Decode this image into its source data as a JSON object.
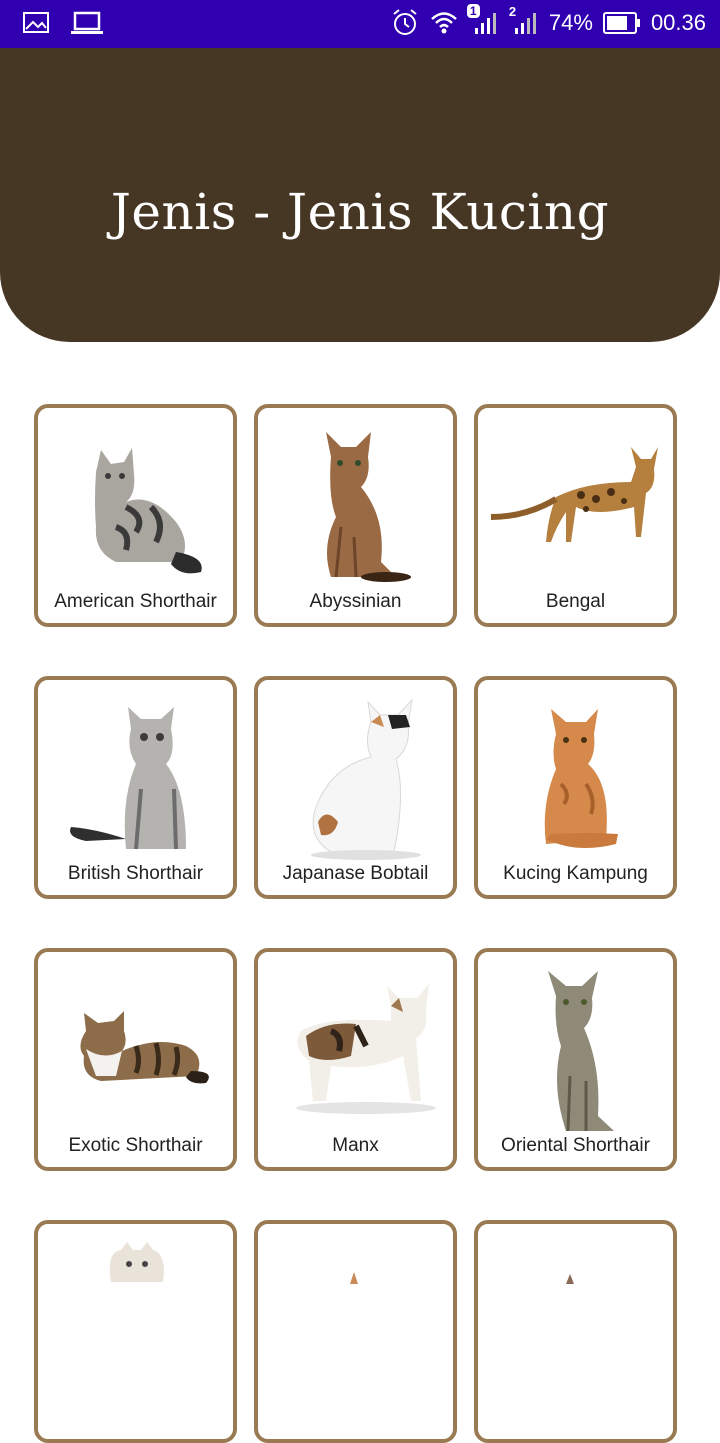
{
  "status": {
    "battery": "74%",
    "time": "00.36",
    "sim1": "1",
    "sim2": "2"
  },
  "header": {
    "title": "Jenis - Jenis Kucing"
  },
  "cats": [
    {
      "label": "American Shorthair"
    },
    {
      "label": "Abyssinian"
    },
    {
      "label": "Bengal"
    },
    {
      "label": "British Shorthair"
    },
    {
      "label": "Japanase Bobtail"
    },
    {
      "label": "Kucing Kampung"
    },
    {
      "label": "Exotic Shorthair"
    },
    {
      "label": "Manx"
    },
    {
      "label": "Oriental Shorthair"
    },
    {
      "label": ""
    },
    {
      "label": ""
    },
    {
      "label": ""
    }
  ],
  "colors": {
    "statusbar": "#3000b0",
    "header": "#463624",
    "card_border": "#9a7a52"
  }
}
